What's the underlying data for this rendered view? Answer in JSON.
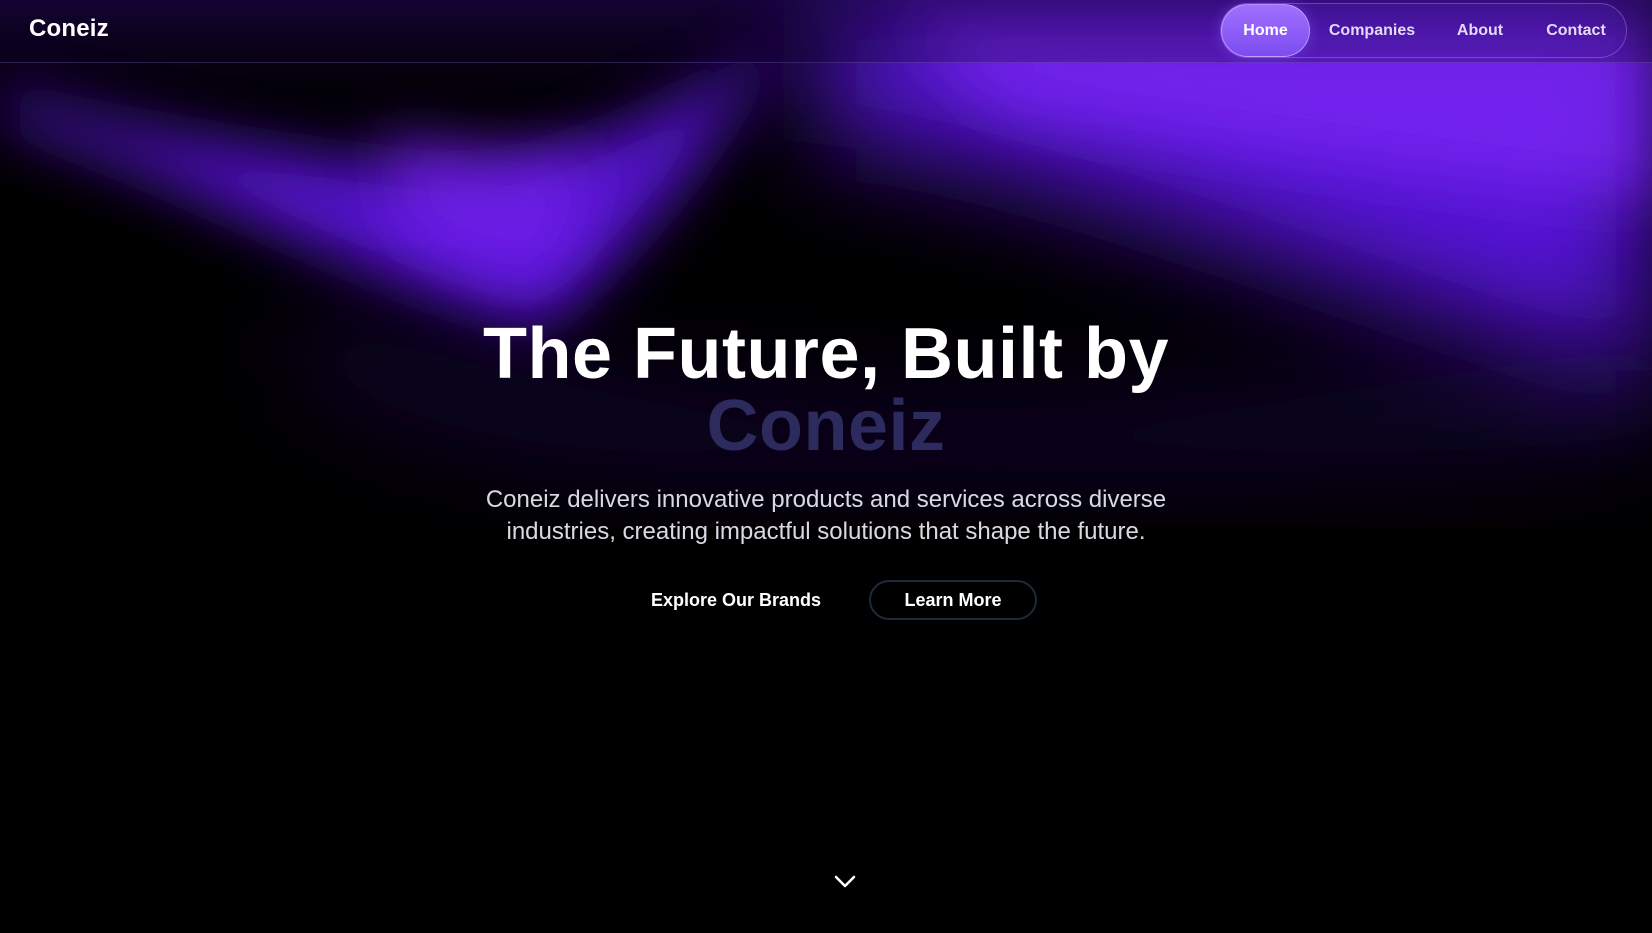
{
  "app": {
    "logo_text": "Coneiz"
  },
  "nav": {
    "items": [
      {
        "label": "Home",
        "active": true
      },
      {
        "label": "Companies",
        "active": false
      },
      {
        "label": "About",
        "active": false
      },
      {
        "label": "Contact",
        "active": false
      }
    ]
  },
  "hero": {
    "title_line1": "The Future, Built by",
    "title_line2": "Coneiz",
    "subtitle_line1": "Coneiz delivers innovative products and services across diverse",
    "subtitle_line2": "industries, creating impactful solutions that shape the future.",
    "primary_button": "Explore Our Brands",
    "secondary_button": "Learn More"
  },
  "icons": {
    "scroll_indicator": "chevron-down-icon"
  },
  "colors": {
    "background": "#000000",
    "accent_purple": "#6a1cf0",
    "nav_active": "#8c5cf6",
    "title_highlight": "#2d2a5e",
    "text": "#ffffff"
  }
}
